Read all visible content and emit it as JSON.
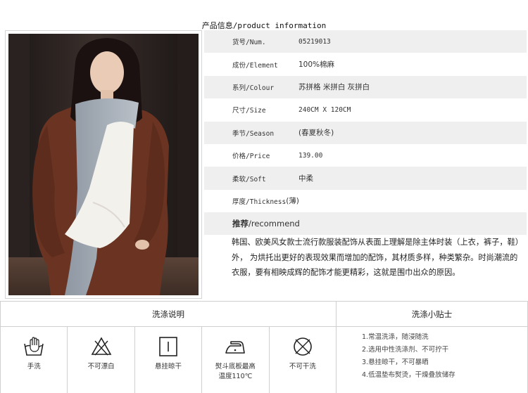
{
  "header": {
    "title_cn": "产品信息",
    "title_en": "/product information"
  },
  "specs": [
    {
      "key": "货号/Num.",
      "value": "05219013"
    },
    {
      "key": "成份/Element",
      "value": "100%棉麻"
    },
    {
      "key": "系列/Colour",
      "value": "苏拼格 米拼白 灰拼白"
    },
    {
      "key": "尺寸/Size",
      "value": "240CM X 120CM"
    },
    {
      "key": "季节/Season",
      "value": "(春夏秋冬)"
    },
    {
      "key": "价格/Price",
      "value": "139.00"
    },
    {
      "key": "柔软/Soft",
      "value": "中柔"
    },
    {
      "key": "厚度/Thickness",
      "value": "(薄)"
    }
  ],
  "recommend": {
    "title_cn": "推荐",
    "title_en": "/recommend",
    "text": "韩国、欧美风女款士流行款服装配饰从表面上理解是除主体时装（上衣，裤子，鞋）外， 为烘托出更好的表现效果而增加的配饰，其材质多样，种类繁杂。时尚潮流的衣服，要有相映成辉的配饰才能更精彩，这就是围巾出众的原因。"
  },
  "care": {
    "title": "洗涤说明",
    "items": [
      {
        "icon": "hand-wash-icon",
        "label": "手洗"
      },
      {
        "icon": "no-bleach-icon",
        "label": "不可漂白"
      },
      {
        "icon": "hang-dry-icon",
        "label": "悬挂晾干"
      },
      {
        "icon": "iron-icon",
        "label": "熨斗底板最高\n温度110℃"
      },
      {
        "icon": "no-tumble-dry-icon",
        "label": "不可干洗"
      }
    ]
  },
  "tips": {
    "title": "洗涤小贴士",
    "items": [
      "1.常温洗涤，随浸随洗",
      "2.选用中性洗涤剂、不可拧干",
      "3.悬挂晾干，不可暴晒",
      "4.低温垫布熨烫，干燥叠放储存"
    ]
  }
}
